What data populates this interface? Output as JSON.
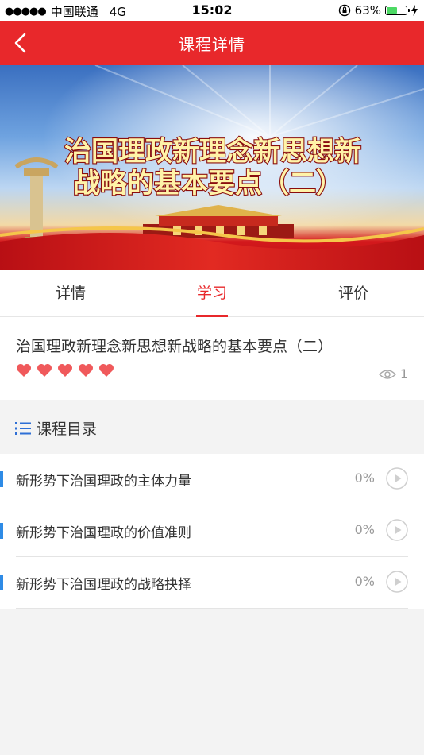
{
  "status": {
    "carrier": "中国联通",
    "network": "4G",
    "time": "15:02",
    "battery": "63%",
    "battery_level": 0.63
  },
  "nav": {
    "title": "课程详情"
  },
  "banner": {
    "line1": "治国理政新理念新思想新",
    "line2": "战略的基本要点（二）"
  },
  "tabs": [
    {
      "label": "详情"
    },
    {
      "label": "学习"
    },
    {
      "label": "评价"
    }
  ],
  "course": {
    "title": "治国理政新理念新思想新战略的基本要点（二）",
    "rating": 5,
    "views": "1"
  },
  "catalog": {
    "header": "课程目录",
    "items": [
      {
        "name": "新形势下治国理政的主体力量",
        "progress": "0%"
      },
      {
        "name": "新形势下治国理政的价值准则",
        "progress": "0%"
      },
      {
        "name": "新形势下治国理政的战略抉择",
        "progress": "0%"
      }
    ]
  },
  "colors": {
    "accent": "#e8282b",
    "list_marker": "#2e8be6"
  }
}
